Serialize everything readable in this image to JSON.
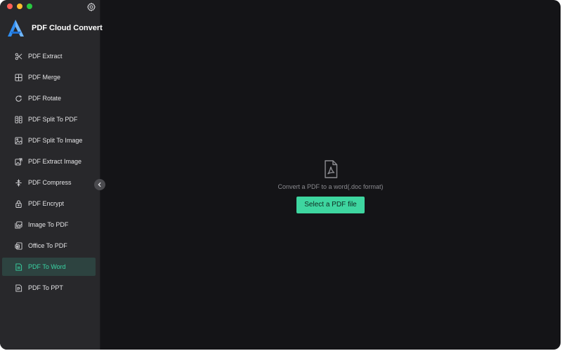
{
  "app": {
    "name": "PDF Cloud Convert"
  },
  "sidebar": {
    "items": [
      {
        "label": "PDF Extract",
        "icon": "scissors-icon",
        "active": false
      },
      {
        "label": "PDF Merge",
        "icon": "merge-icon",
        "active": false
      },
      {
        "label": "PDF Rotate",
        "icon": "rotate-icon",
        "active": false
      },
      {
        "label": "PDF Split To PDF",
        "icon": "split-pdf-icon",
        "active": false
      },
      {
        "label": "PDF Split To Image",
        "icon": "split-image-icon",
        "active": false
      },
      {
        "label": "PDF Extract Image",
        "icon": "extract-image-icon",
        "active": false
      },
      {
        "label": "PDF Compress",
        "icon": "compress-icon",
        "active": false
      },
      {
        "label": "PDF Encrypt",
        "icon": "lock-icon",
        "active": false
      },
      {
        "label": "Image To PDF",
        "icon": "images-icon",
        "active": false
      },
      {
        "label": "Office To PDF",
        "icon": "office-icon",
        "active": false
      },
      {
        "label": "PDF To Word",
        "icon": "word-doc-icon",
        "active": true
      },
      {
        "label": "PDF To PPT",
        "icon": "ppt-doc-icon",
        "active": false
      }
    ]
  },
  "main": {
    "hint": "Convert a PDF to a word(.doc format)",
    "select_button": "Select a PDF file"
  },
  "colors": {
    "accent": "#3ed6a0",
    "active_text": "#39d5a4",
    "active_bg": "#2d4340",
    "sidebar_bg": "#28282b",
    "main_bg": "#141417",
    "brand_blue": "#2f8df0"
  }
}
